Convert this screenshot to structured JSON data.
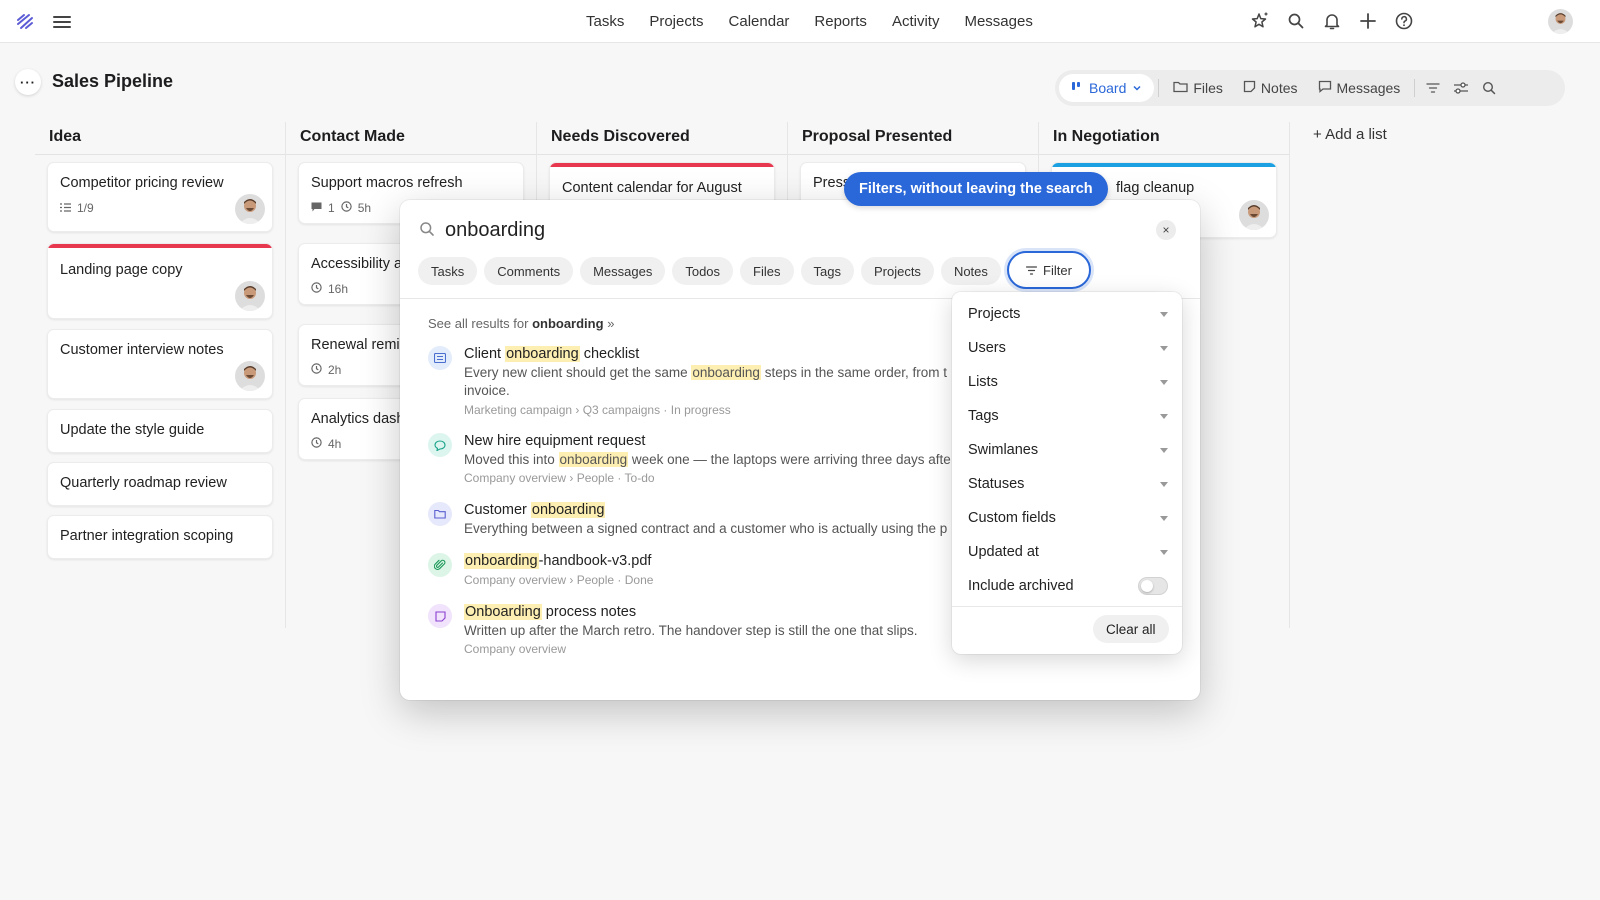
{
  "nav": {
    "links": [
      "Tasks",
      "Projects",
      "Calendar",
      "Reports",
      "Activity",
      "Messages"
    ]
  },
  "header": {
    "title": "Sales Pipeline",
    "more": "···",
    "views": {
      "board": "Board",
      "files": "Files",
      "notes": "Notes",
      "messages": "Messages"
    }
  },
  "board": {
    "columns": [
      {
        "title": "Idea"
      },
      {
        "title": "Contact Made"
      },
      {
        "title": "Needs Discovered"
      },
      {
        "title": "Proposal Presented"
      },
      {
        "title": "In Negotiation"
      }
    ],
    "cards": {
      "c0_0": {
        "title": "Competitor pricing review",
        "meta": "1/9"
      },
      "c0_1": {
        "title": "Landing page copy"
      },
      "c0_2": {
        "title": "Customer interview notes"
      },
      "c0_3": {
        "title": "Update the style guide"
      },
      "c0_4": {
        "title": "Quarterly roadmap review"
      },
      "c0_5": {
        "title": "Partner integration scoping"
      },
      "c1_0": {
        "title": "Support macros refresh",
        "comments": "1",
        "time": "5h"
      },
      "c1_1": {
        "title": "Accessibility a",
        "time": "16h"
      },
      "c1_2": {
        "title": "Renewal remin",
        "time": "2h"
      },
      "c1_3": {
        "title": "Analytics dash",
        "time": "4h"
      },
      "c2_0": {
        "title": "Content calendar for August"
      },
      "c3_0": {
        "title": "Press"
      },
      "c4_0": {
        "title": "flag cleanup"
      }
    },
    "add_list": "Add a list"
  },
  "search": {
    "query": "onboarding",
    "close": "×",
    "chips": [
      "Tasks",
      "Comments",
      "Messages",
      "Todos",
      "Files",
      "Tags",
      "Projects",
      "Notes"
    ],
    "filter_label": "Filter",
    "see_all_prefix": "See all results for",
    "see_all_term": "onboarding",
    "see_all_suffix": "»",
    "results": [
      {
        "title_pre": "Client ",
        "title_hl": "onboarding",
        "title_post": " checklist",
        "snippet_pre": "Every new client should get the same ",
        "snippet_hl": "onboarding",
        "snippet_post": " steps in the same order, from t",
        "snippet2": "invoice.",
        "path": "Marketing campaign › Q3 campaigns · In progress"
      },
      {
        "title_pre": "New hire equipment request",
        "title_hl": "",
        "title_post": "",
        "snippet_pre": "Moved this into ",
        "snippet_hl": "onboarding",
        "snippet_post": " week one — the laptops were arriving three days afte",
        "path": "Company overview › People · To-do"
      },
      {
        "title_pre": "Customer ",
        "title_hl": "onboarding",
        "title_post": "",
        "snippet_pre": "Everything between a signed contract and a customer who is actually using the p",
        "snippet_hl": "",
        "snippet_post": ""
      },
      {
        "title_pre": "",
        "title_hl": "onboarding",
        "title_post": "-handbook-v3.pdf",
        "path": "Company overview › People · Done"
      },
      {
        "title_pre": "",
        "title_hl": "Onboarding",
        "title_post": " process notes",
        "snippet_pre": "Written up after the March retro. The handover step is still the one that slips.",
        "snippet_hl": "",
        "snippet_post": "",
        "path": "Company overview"
      }
    ]
  },
  "tooltip": "Filters, without leaving the search",
  "filter_panel": {
    "rows": [
      "Projects",
      "Users",
      "Lists",
      "Tags",
      "Swimlanes",
      "Statuses",
      "Custom fields",
      "Updated at"
    ],
    "include_archived": "Include archived",
    "include_archived_on": false,
    "clear_all": "Clear all"
  },
  "colors": {
    "accent": "#2a67d8",
    "red_band": "#e8384f",
    "blue_band": "#1ba1e2",
    "highlight": "#fdeeb2"
  }
}
